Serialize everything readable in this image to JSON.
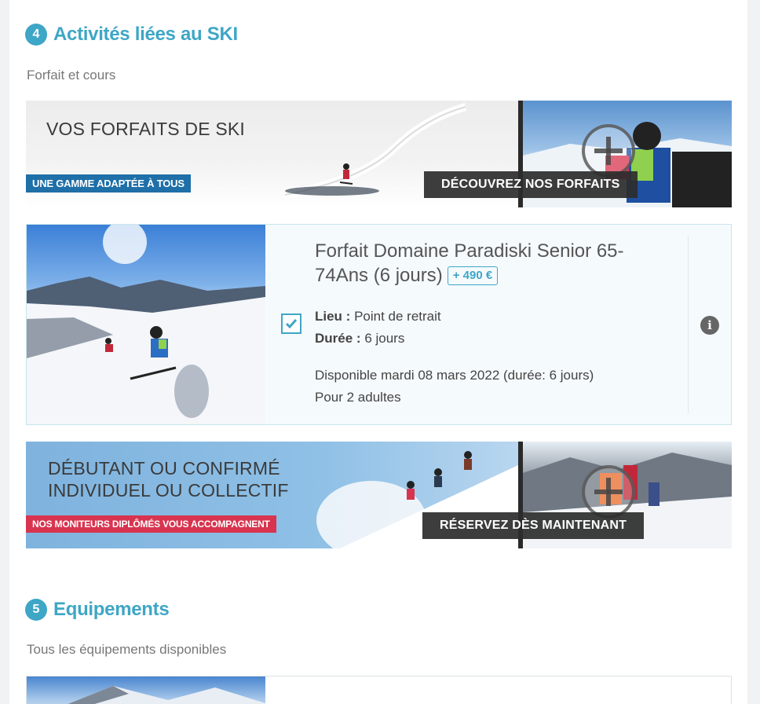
{
  "section4": {
    "number": "4",
    "title": "Activités liées au SKI",
    "subtitle": "Forfait et cours"
  },
  "banner_forfaits": {
    "headline": "VOS FORFAITS DE SKI",
    "tag": "UNE GAMME ADAPTÉE À TOUS",
    "cta": "DÉCOUVREZ NOS FORFAITS",
    "tag_color": "#1f6fa8"
  },
  "product": {
    "title": "Forfait Domaine Paradiski Senior 65-74Ans (6 jours)",
    "price_badge": "+ 490 €",
    "lieu_label": "Lieu :",
    "lieu_value": "Point de retrait",
    "duree_label": "Durée :",
    "duree_value": "6 jours",
    "availability": "Disponible mardi 08 mars 2022 (durée: 6 jours)",
    "people": "Pour 2 adultes",
    "selected": true
  },
  "banner_cours": {
    "line1": "DÉBUTANT OU CONFIRMÉ",
    "line2": "INDIVIDUEL OU COLLECTIF",
    "tag": "NOS MONITEURS DIPLÔMÉS VOUS ACCOMPAGNENT",
    "cta": "RÉSERVEZ DÈS MAINTENANT",
    "tag_color": "#d8344f"
  },
  "section5": {
    "number": "5",
    "title": "Equipements",
    "subtitle": "Tous les équipements disponibles"
  },
  "colors": {
    "accent": "#3ea6c6"
  }
}
